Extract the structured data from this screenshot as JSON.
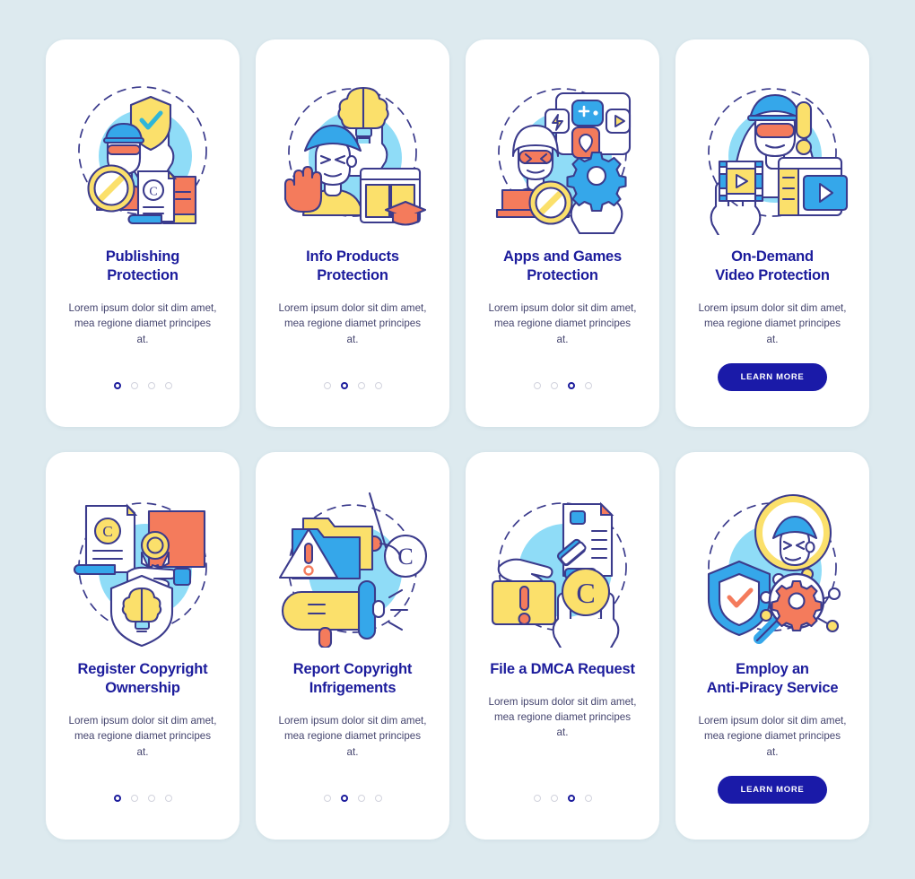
{
  "page": {
    "background_color": "#ddeaef",
    "card_background": "#ffffff",
    "title_color": "#1c1c9c",
    "body_color": "#44446e",
    "accent_blue": "#1a1aa8",
    "illustration_colors": {
      "outline": "#3b3b8c",
      "cyan": "#8fdcf7",
      "blue": "#35a7ea",
      "yellow": "#fbe06b",
      "orange": "#f47b5c",
      "white": "#ffffff"
    }
  },
  "body_text": "Lorem ipsum dolor sit dim amet, mea regione diamet principes at.",
  "learn_more_label": "LEARN MORE",
  "cards": [
    {
      "id": "publishing-protection",
      "title": "Publishing\nProtection",
      "body": "Lorem ipsum dolor sit dim amet, mea regione diamet principes at.",
      "illustration": "publishing-protection-illustration",
      "footer_type": "dots",
      "dots_total": 4,
      "dot_active_index": 0
    },
    {
      "id": "info-products-protection",
      "title": "Info Products\nProtection",
      "body": "Lorem ipsum dolor sit dim amet, mea regione diamet principes at.",
      "illustration": "info-products-protection-illustration",
      "footer_type": "dots",
      "dots_total": 4,
      "dot_active_index": 1
    },
    {
      "id": "apps-and-games-protection",
      "title": "Apps and Games\nProtection",
      "body": "Lorem ipsum dolor sit dim amet, mea regione diamet principes at.",
      "illustration": "apps-and-games-protection-illustration",
      "footer_type": "dots",
      "dots_total": 4,
      "dot_active_index": 2
    },
    {
      "id": "on-demand-video-protection",
      "title": "On-Demand\nVideo Protection",
      "body": "Lorem ipsum dolor sit dim amet, mea regione diamet principes at.",
      "illustration": "on-demand-video-protection-illustration",
      "footer_type": "button",
      "button_label": "LEARN MORE"
    },
    {
      "id": "register-copyright-ownership",
      "title": "Register Copyright\nOwnership",
      "body": "Lorem ipsum dolor sit dim amet, mea regione diamet principes at.",
      "illustration": "register-copyright-ownership-illustration",
      "footer_type": "dots",
      "dots_total": 4,
      "dot_active_index": 0
    },
    {
      "id": "report-copyright-infrigements",
      "title": "Report Copyright\nInfrigements",
      "body": "Lorem ipsum dolor sit dim amet, mea regione diamet principes at.",
      "illustration": "report-copyright-infrigements-illustration",
      "footer_type": "dots",
      "dots_total": 4,
      "dot_active_index": 1
    },
    {
      "id": "file-a-dmca-request",
      "title": "File a DMCA Request",
      "body": "Lorem ipsum dolor sit dim amet, mea regione diamet principes at.",
      "illustration": "file-a-dmca-request-illustration",
      "footer_type": "dots",
      "dots_total": 4,
      "dot_active_index": 2
    },
    {
      "id": "employ-an-anti-piracy-service",
      "title": "Employ an\nAnti-Piracy Service",
      "body": "Lorem ipsum dolor sit dim amet, mea regione diamet principes at.",
      "illustration": "employ-an-anti-piracy-service-illustration",
      "footer_type": "button",
      "button_label": "LEARN MORE"
    }
  ]
}
